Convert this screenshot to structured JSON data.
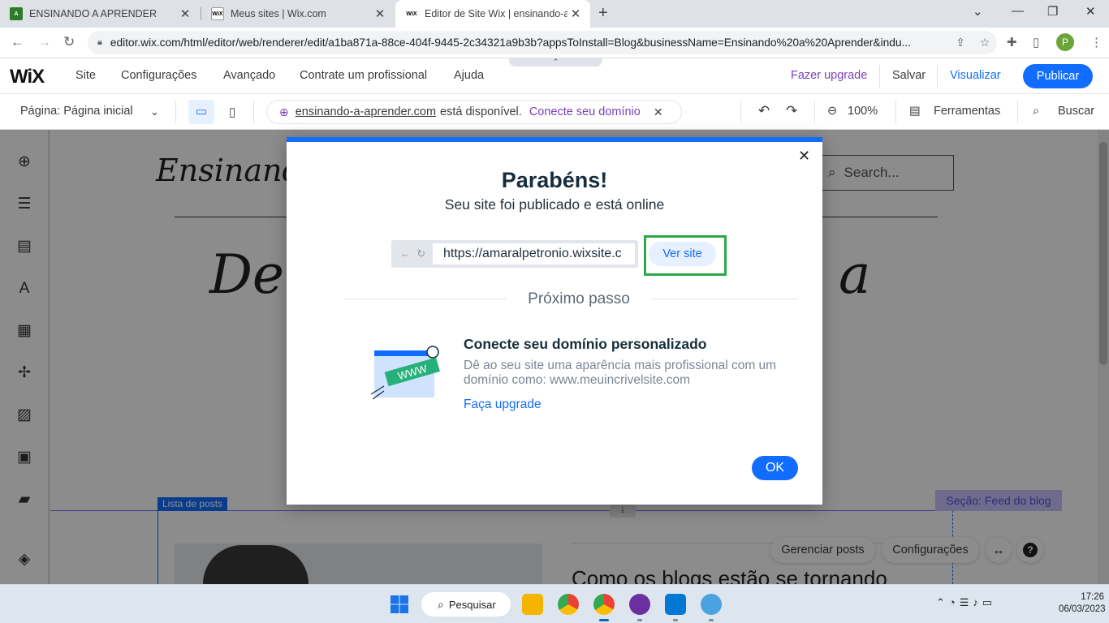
{
  "browser": {
    "tabs": [
      {
        "title": "ENSINANDO A APRENDER",
        "favicon": "A"
      },
      {
        "title": "Meus sites | Wix.com",
        "favicon": "WiX"
      },
      {
        "title": "Editor de Site Wix | ensinando-a-",
        "favicon": "WiX"
      }
    ],
    "url": "editor.wix.com/html/editor/web/renderer/edit/a1ba871a-88ce-404f-9445-2c34321a9b3b?appsToInstall=Blog&businessName=Ensinando%20a%20Aprender&indu...",
    "profile_initial": "P"
  },
  "wix_top": {
    "logo": "WiX",
    "menu": [
      "Site",
      "Configurações",
      "Avançado",
      "Contrate um profissional",
      "Ajuda"
    ],
    "upgrade": "Fazer upgrade",
    "save": "Salvar",
    "preview": "Visualizar",
    "publish": "Publicar"
  },
  "wix_bar2": {
    "page_select": "Página: Página inicial",
    "domain": "ensinando-a-aprender.com",
    "domain_status": "está disponível.",
    "domain_link": "Conecte seu domínio",
    "zoom": "100%",
    "tools": "Ferramentas",
    "search": "Buscar"
  },
  "canvas": {
    "site_title": "Ensinando",
    "search_placeholder": "Search...",
    "big_text_left": "De",
    "big_text_right": "a",
    "posts_label": "Lista de posts",
    "feed_label": "Seção: Feed do blog",
    "post_title": "Como os blogs estão se tornando",
    "manage_posts": "Gerenciar posts",
    "settings": "Configurações"
  },
  "dialog": {
    "title": "Parabéns!",
    "subtitle": "Seu site foi publicado e está online",
    "site_url": "https://amaralpetronio.wixsite.c",
    "view_site": "Ver site",
    "next_step": "Próximo passo",
    "illustration_text": "WWW",
    "connect_title": "Conecte seu domínio personalizado",
    "connect_desc": "Dê ao seu site uma aparência mais profissional com um domínio como: www.meuincrivelsite.com",
    "upgrade_link": "Faça upgrade",
    "ok": "OK"
  },
  "taskbar": {
    "search": "Pesquisar",
    "time": "17:26",
    "date": "06/03/2023"
  },
  "colors": {
    "wix_blue": "#116dff",
    "purple": "#7a3fb5",
    "highlight_green": "#2ca84a"
  }
}
